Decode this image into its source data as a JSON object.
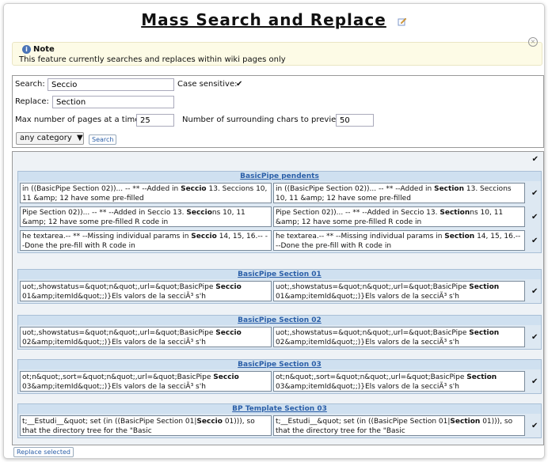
{
  "page": {
    "title": "Mass Search and Replace"
  },
  "note": {
    "heading": "Note",
    "text": "This feature currently searches and replaces within wiki pages only"
  },
  "form": {
    "search_label": "Search:",
    "search_value": "Seccio",
    "case_label": "Case sensitive:",
    "case_checked": "✔",
    "replace_label": "Replace:",
    "replace_value": "Section",
    "max_label": "Max number of pages at a time:",
    "max_value": "25",
    "chars_label": "Number of surrounding chars to preview:",
    "chars_value": "50",
    "category_value": "any category",
    "search_button": "Search"
  },
  "select_all_check": "✔",
  "groups": [
    {
      "title": "BasicPipe pendents"
    },
    {
      "title": "BasicPipe Section 01"
    },
    {
      "title": "BasicPipe Section 02"
    },
    {
      "title": "BasicPipe Section 03"
    },
    {
      "title": "BP Template Section 03"
    }
  ],
  "rows": {
    "r1": {
      "l_pre": "in ((BasicPipe Section 02))... -- ** --Added in ",
      "l_hit": "Seccio",
      "l_post": " 13. Seccions 10, 11 &amp; 12 have some pre-filled",
      "r_pre": "in ((BasicPipe Section 02))... -- ** --Added in ",
      "r_hit": "Section",
      "r_post": " 13. Seccions 10, 11 &amp; 12 have some pre-filled"
    },
    "r2": {
      "l_pre": "Pipe Section 02))... -- ** --Added in Seccio 13. ",
      "l_hit": "Seccio",
      "l_post": "ns 10, 11 &amp; 12 have some pre-filled R code in",
      "r_pre": "Pipe Section 02))... -- ** --Added in Seccio 13. ",
      "r_hit": "Section",
      "r_post": "ns 10, 11 &amp; 12 have some pre-filled R code in"
    },
    "r3": {
      "l_pre": "he textarea.-- ** --Missing individual params in ",
      "l_hit": "Seccio",
      "l_post": " 14, 15, 16.-- --Done the pre-fill with R code in",
      "r_pre": "he textarea.-- ** --Missing individual params in ",
      "r_hit": "Section",
      "r_post": " 14, 15, 16.-- --Done the pre-fill with R code in"
    },
    "r4": {
      "l_pre": "uot;,showstatus=&quot;n&quot;,url=&quot;BasicPipe ",
      "l_hit": "Seccio",
      "l_post": " 01&amp;itemId&quot;;)}Els valors de la secciÃ³ s'h",
      "r_pre": "uot;,showstatus=&quot;n&quot;,url=&quot;BasicPipe ",
      "r_hit": "Section",
      "r_post": " 01&amp;itemId&quot;;)}Els valors de la secciÃ³ s'h"
    },
    "r5": {
      "l_pre": "uot;,showstatus=&quot;n&quot;,url=&quot;BasicPipe ",
      "l_hit": "Seccio",
      "l_post": " 02&amp;itemId&quot;;)}Els valors de la secciÃ³ s'h",
      "r_pre": "uot;,showstatus=&quot;n&quot;,url=&quot;BasicPipe ",
      "r_hit": "Section",
      "r_post": " 02&amp;itemId&quot;;)}Els valors de la secciÃ³ s'h"
    },
    "r6": {
      "l_pre": "ot;n&quot;,sort=&quot;n&quot;,url=&quot;BasicPipe ",
      "l_hit": "Seccio",
      "l_post": " 03&amp;itemId&quot;;)}Els valors de la secciÃ³ s'h",
      "r_pre": "ot;n&quot;,sort=&quot;n&quot;,url=&quot;BasicPipe ",
      "r_hit": "Section",
      "r_post": " 03&amp;itemId&quot;;)}Els valors de la secciÃ³ s'h"
    },
    "r7": {
      "l_pre": "t;__Estudi__&quot; set (in ((BasicPipe Section 01|",
      "l_hit": "Seccio",
      "l_post": " 01))), so that the directory tree for the \"Basic",
      "r_pre": "t;__Estudi__&quot; set (in ((BasicPipe Section 01|",
      "r_hit": "Section",
      "r_post": " 01))), so that the directory tree for the \"Basic"
    }
  },
  "row_check": "✔",
  "replace_button": "Replace selected"
}
